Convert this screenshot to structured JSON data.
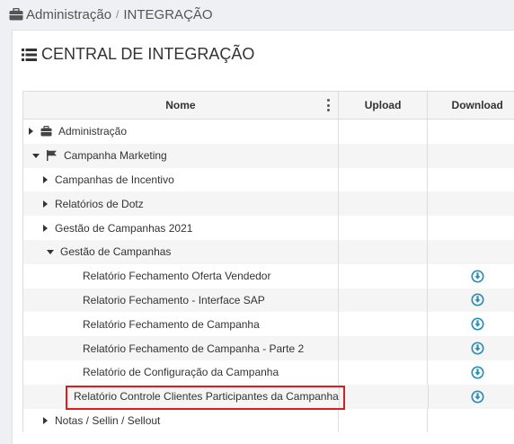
{
  "breadcrumb": {
    "parent": "Administração",
    "separator": "/",
    "current": "INTEGRAÇÃO"
  },
  "page": {
    "title": "CENTRAL DE INTEGRAÇÃO"
  },
  "grid": {
    "columns": {
      "name": "Nome",
      "upload": "Upload",
      "download": "Download"
    },
    "rows": [
      {
        "label": "Administração",
        "expander": "collapsed",
        "icon": "briefcase-icon",
        "download": false
      },
      {
        "label": "Campanha Marketing",
        "expander": "expanded",
        "icon": "flag-icon",
        "download": false
      },
      {
        "label": "Campanhas de Incentivo",
        "expander": "collapsed",
        "icon": "",
        "download": false
      },
      {
        "label": "Relatórios de Dotz",
        "expander": "collapsed",
        "icon": "",
        "download": false
      },
      {
        "label": "Gestão de Campanhas 2021",
        "expander": "collapsed",
        "icon": "",
        "download": false
      },
      {
        "label": "Gestão de Campanhas",
        "expander": "expanded",
        "icon": "",
        "download": false
      },
      {
        "label": "Relatório Fechamento Oferta Vendedor",
        "expander": "none",
        "icon": "",
        "download": true
      },
      {
        "label": "Relatorio Fechamento - Interface SAP",
        "expander": "none",
        "icon": "",
        "download": true
      },
      {
        "label": "Relatório Fechamento de Campanha",
        "expander": "none",
        "icon": "",
        "download": true
      },
      {
        "label": "Relatório Fechamento de Campanha - Parte 2",
        "expander": "none",
        "icon": "",
        "download": true
      },
      {
        "label": "Relatório de Configuração da Campanha",
        "expander": "none",
        "icon": "",
        "download": true
      },
      {
        "label": "Relatório Controle Clientes Participantes da Campanha",
        "expander": "none",
        "icon": "",
        "download": true,
        "highlighted": true
      },
      {
        "label": "Notas / Sellin / Sellout",
        "expander": "collapsed",
        "icon": "",
        "download": false
      }
    ]
  },
  "colors": {
    "download_icon": "#2a8fb4",
    "highlight_border": "#e01b1b"
  }
}
